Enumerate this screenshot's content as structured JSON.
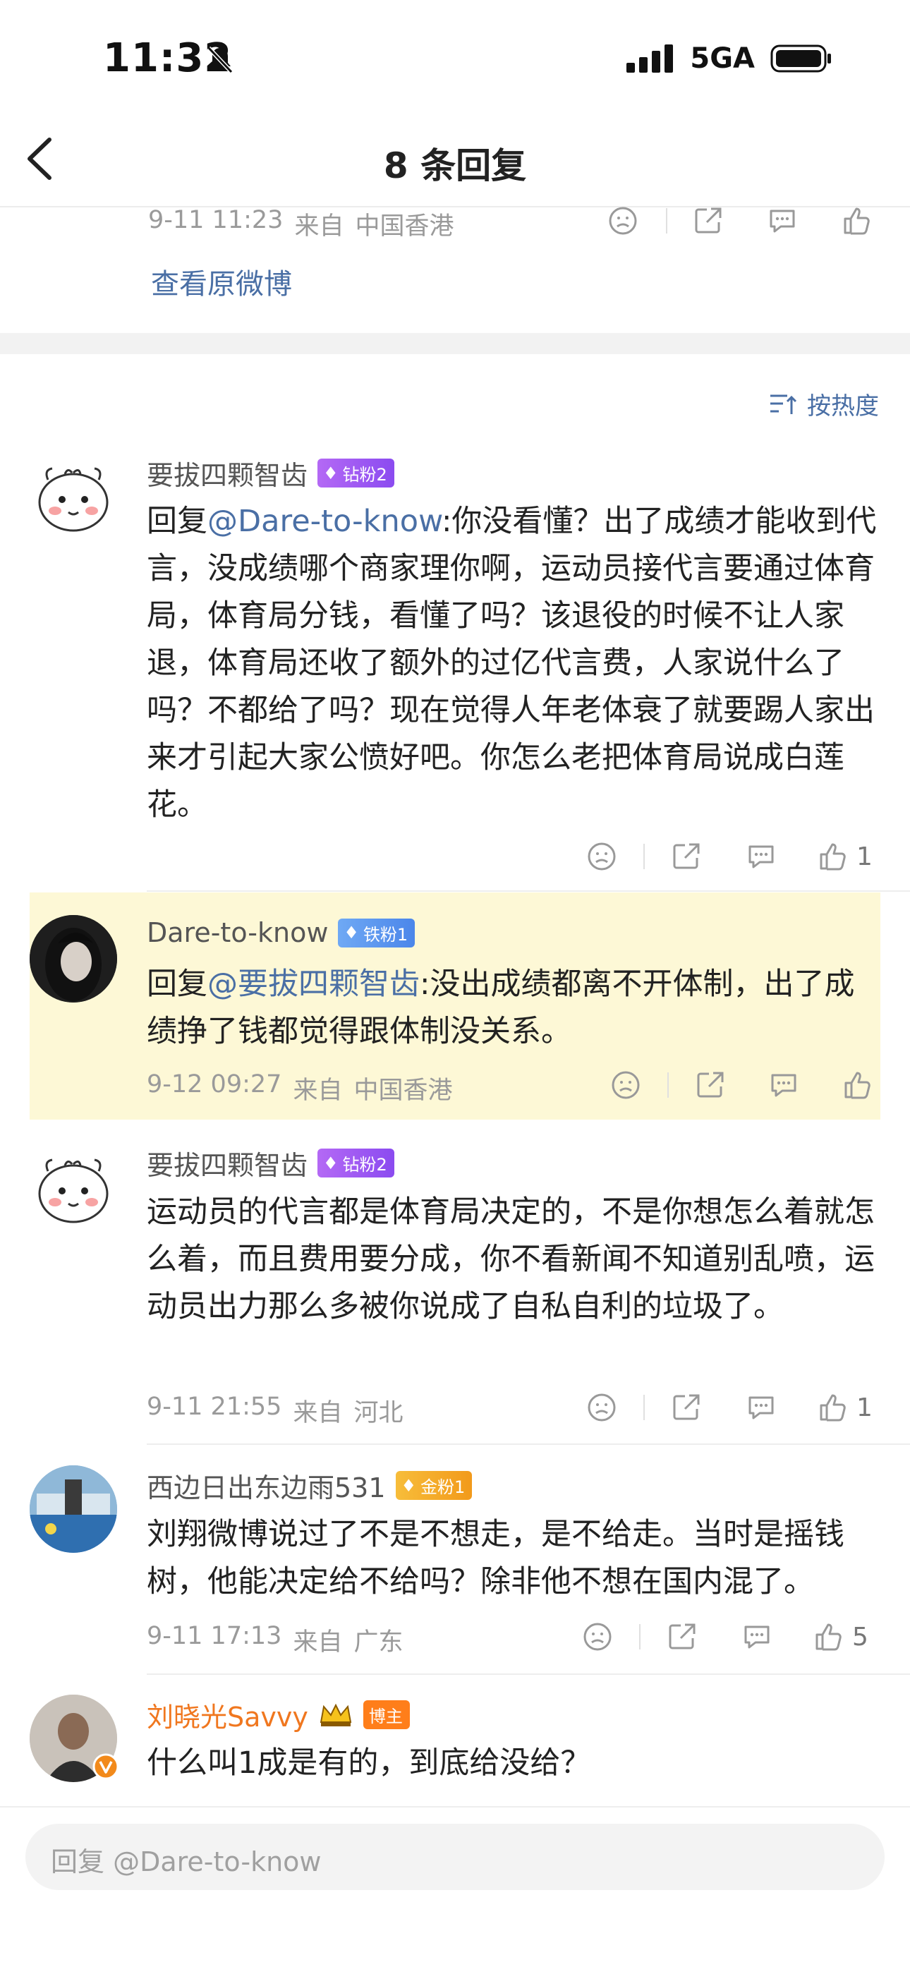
{
  "status": {
    "time": "11:32",
    "network": "5GA"
  },
  "nav": {
    "title": "8 条回复"
  },
  "top_post": {
    "date": "9-11 11:23",
    "from_label": "来自",
    "location": "中国香港",
    "view_original": "查看原微博"
  },
  "sort_label": "按热度",
  "comments": [
    {
      "name": "要拔四颗智齿",
      "badge": "钻粉2",
      "reply_prefix": "回复",
      "mention": "@Dare-to-know",
      "text": ":你没看懂？出了成绩才能收到代言，没成绩哪个商家理你啊，运动员接代言要通过体育局，体育局分钱，看懂了吗？该退役的时候不让人家退，体育局还收了额外的过亿代言费，人家说什么了吗？不都给了吗？现在觉得人年老体衰了就要踢人家出来才引起大家公愤好吧。你怎么老把体育局说成白莲花。",
      "likes": "1"
    },
    {
      "name": "Dare-to-know",
      "badge": "铁粉1",
      "reply_prefix": "回复",
      "mention": "@要拔四颗智齿",
      "text": ":没出成绩都离不开体制，出了成绩挣了钱都觉得跟体制没关系。",
      "date": "9-12 09:27",
      "from_label": "来自",
      "location": "中国香港"
    },
    {
      "name": "要拔四颗智齿",
      "badge": "钻粉2",
      "text": "运动员的代言都是体育局决定的，不是你想怎么着就怎么着，而且费用要分成，你不看新闻不知道别乱喷，运动员出力那么多被你说成了自私自利的垃圾了。",
      "date": "9-11 21:55",
      "from_label": "来自",
      "location": "河北",
      "likes": "1"
    },
    {
      "name": "西边日出东边雨531",
      "badge": "金粉1",
      "text": "刘翔微博说过了不是不想走，是不给走。当时是摇钱树，他能决定给不给吗？除非他不想在国内混了。",
      "date": "9-11 17:13",
      "from_label": "来自",
      "location": "广东",
      "likes": "5"
    },
    {
      "name": "刘晓光Savvy",
      "badge": "博主",
      "text": "什么叫1成是有的，到底给没给？"
    }
  ],
  "input": {
    "placeholder": "回复 @Dare-to-know"
  },
  "colors": {
    "link": "#4a6fa5",
    "highlight": "#fdf8d6",
    "orange_name": "#f0771f"
  }
}
